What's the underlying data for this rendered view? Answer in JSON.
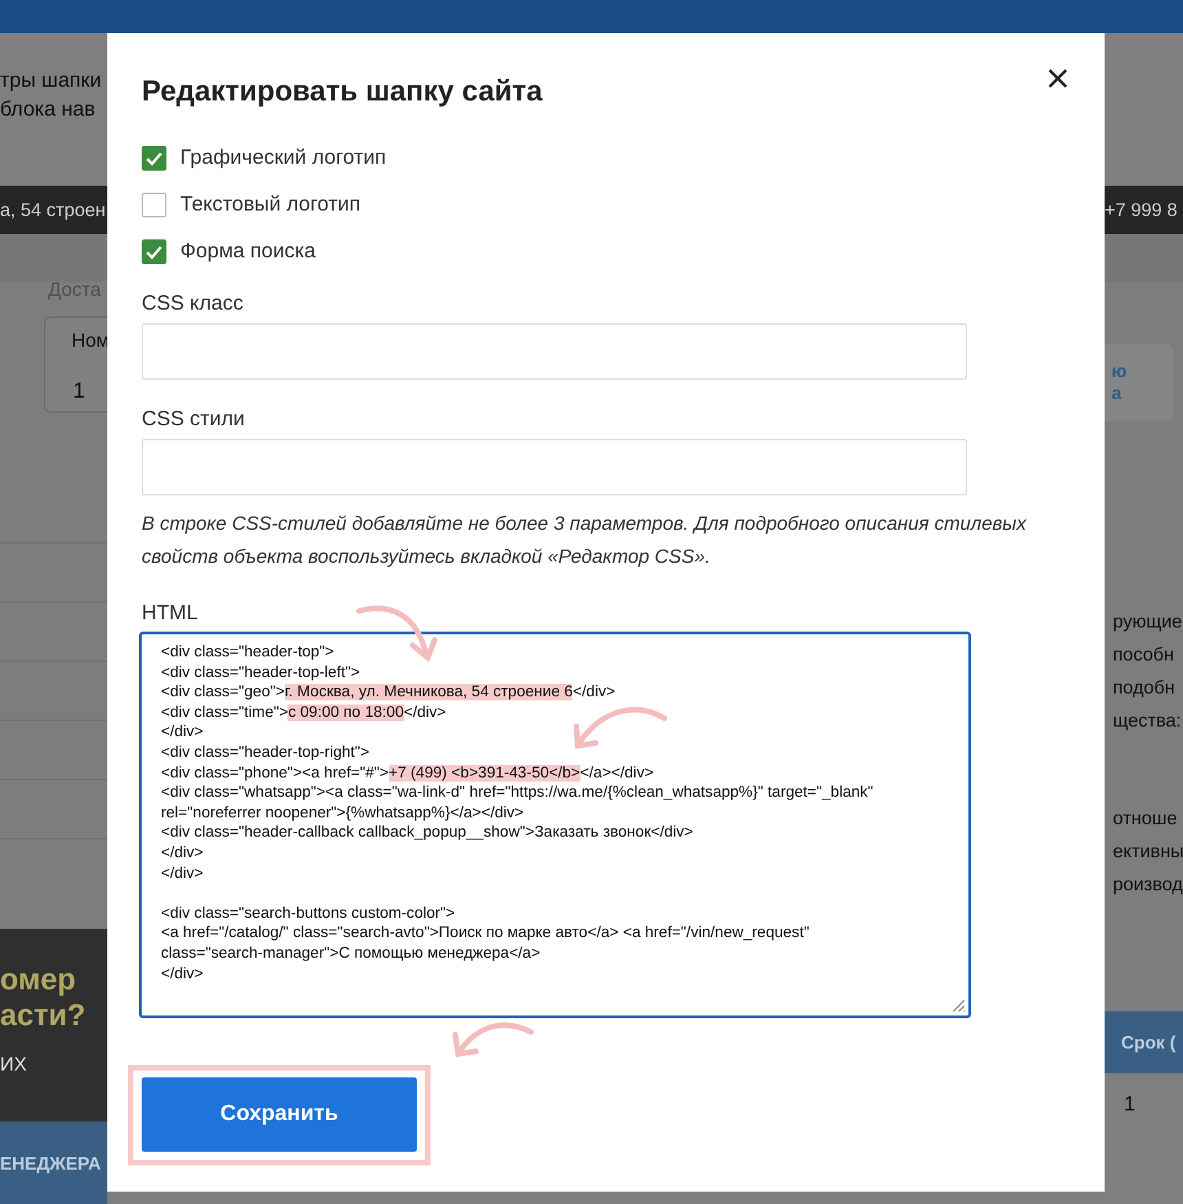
{
  "background": {
    "intro_lines": [
      "тры шапки",
      "блока нав"
    ],
    "address_fragment": "а, 54 строен",
    "phone_fragment": "+7 999 8",
    "tab_fragment": "Доста",
    "card": {
      "label": "Ном",
      "value": "1"
    },
    "right_card_lines": [
      "ю",
      "а"
    ],
    "right_paragraph_1": [
      "рующие",
      "пособн",
      "подобн",
      "щества:"
    ],
    "right_paragraph_2": [
      "отноше",
      "ективны",
      "роизвод"
    ],
    "promo_lines": [
      "омер",
      "асти?"
    ],
    "promo_sub": "ИХ",
    "promo_button": "ЕНЕДЖЕРА",
    "table_header": "Срок (",
    "table_cell": "1"
  },
  "modal": {
    "title": "Редактировать шапку сайта",
    "options": [
      {
        "label": "Графический логотип",
        "checked": true
      },
      {
        "label": "Текстовый логотип",
        "checked": false
      },
      {
        "label": "Форма поиска",
        "checked": true
      }
    ],
    "css_class": {
      "label": "CSS класс"
    },
    "css_styles": {
      "label": "CSS стили"
    },
    "hint": "В строке CSS-стилей добавляйте не более 3 параметров. Для подробного описания стилевых свойств объекта воспользуйтесь вкладкой «Редактор CSS».",
    "html": {
      "label": "HTML",
      "lines": [
        {
          "segments": [
            {
              "text": "<div class=\"header-top\">",
              "highlighted": false
            }
          ]
        },
        {
          "segments": [
            {
              "text": "<div class=\"header-top-left\">",
              "highlighted": false
            }
          ]
        },
        {
          "segments": [
            {
              "text": "<div class=\"geo\">",
              "highlighted": false
            },
            {
              "text": "г. Москва, ул. Мечникова, 54 строение 6",
              "highlighted": true
            },
            {
              "text": "</div>",
              "highlighted": false
            }
          ]
        },
        {
          "segments": [
            {
              "text": "<div class=\"time\">",
              "highlighted": false
            },
            {
              "text": "с 09:00 по 18:00",
              "highlighted": true
            },
            {
              "text": "</div>",
              "highlighted": false
            }
          ]
        },
        {
          "segments": [
            {
              "text": "</div>",
              "highlighted": false
            }
          ]
        },
        {
          "segments": [
            {
              "text": "<div class=\"header-top-right\">",
              "highlighted": false
            }
          ]
        },
        {
          "segments": [
            {
              "text": "<div class=\"phone\"><a href=\"#\">",
              "highlighted": false
            },
            {
              "text": "+7 (499) <b>391-43-50</b>",
              "highlighted": true
            },
            {
              "text": "</a></div>",
              "highlighted": false
            }
          ]
        },
        {
          "segments": [
            {
              "text": "<div class=\"whatsapp\"><a class=\"wa-link-d\" href=\"https://wa.me/{%clean_whatsapp%}\" target=\"_blank\"",
              "highlighted": false
            }
          ]
        },
        {
          "segments": [
            {
              "text": "rel=\"noreferrer noopener\">{%whatsapp%}</a></div>",
              "highlighted": false
            }
          ]
        },
        {
          "segments": [
            {
              "text": "<div class=\"header-callback callback_popup__show\">Заказать звонок</div>",
              "highlighted": false
            }
          ]
        },
        {
          "segments": [
            {
              "text": "</div>",
              "highlighted": false
            }
          ]
        },
        {
          "segments": [
            {
              "text": "</div>",
              "highlighted": false
            }
          ]
        },
        {
          "blank_before": true,
          "segments": [
            {
              "text": "<div class=\"search-buttons custom-color\">",
              "highlighted": false
            }
          ]
        },
        {
          "segments": [
            {
              "text": "<a href=\"/catalog/\" class=\"search-avto\">Поиск по марке авто</a> <a href=\"/vin/new_request\"",
              "highlighted": false
            }
          ]
        },
        {
          "segments": [
            {
              "text": "class=\"search-manager\">С помощью менеджера</a>",
              "highlighted": false
            }
          ]
        },
        {
          "segments": [
            {
              "text": "</div>",
              "highlighted": false
            }
          ]
        }
      ]
    },
    "save_button": "Сохранить"
  }
}
